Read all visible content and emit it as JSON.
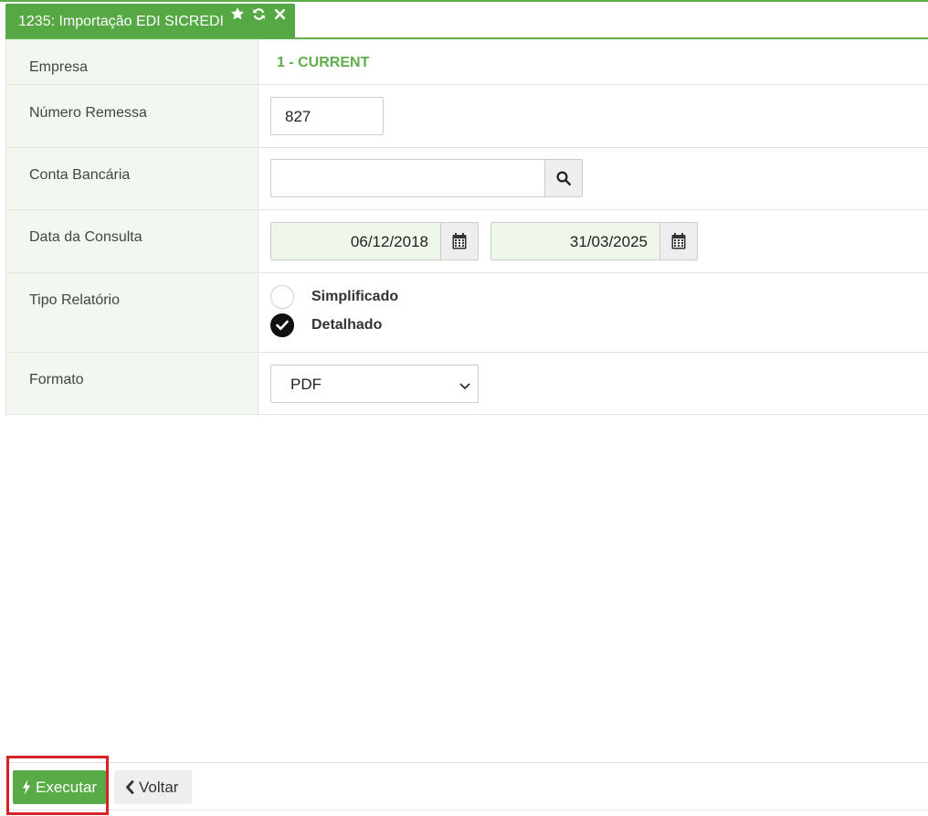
{
  "tab": {
    "title": "1235: Importação EDI SICREDI",
    "icons": [
      "star-icon",
      "refresh-icon",
      "close-icon"
    ]
  },
  "form": {
    "empresa": {
      "label": "Empresa",
      "value": "1 - CURRENT"
    },
    "numero_remessa": {
      "label": "Número Remessa",
      "value": "827"
    },
    "conta_bancaria": {
      "label": "Conta Bancária",
      "value": "",
      "button_icon": "search-icon"
    },
    "data_consulta": {
      "label": "Data da Consulta",
      "start": "06/12/2018",
      "end": "31/03/2025",
      "button_icon": "calendar-icon"
    },
    "tipo_relatorio": {
      "label": "Tipo Relatório",
      "options": [
        {
          "label": "Simplificado",
          "checked": false
        },
        {
          "label": "Detalhado",
          "checked": true
        }
      ]
    },
    "formato": {
      "label": "Formato",
      "selected": "PDF"
    }
  },
  "footer": {
    "executar_label": "Executar",
    "voltar_label": "Voltar"
  },
  "colors": {
    "accent_green": "#55a844",
    "empresa_text": "#5fae4a",
    "highlight_red": "#d6232a",
    "date_bg": "#eef7ea",
    "label_bg": "#f2f8f0"
  }
}
